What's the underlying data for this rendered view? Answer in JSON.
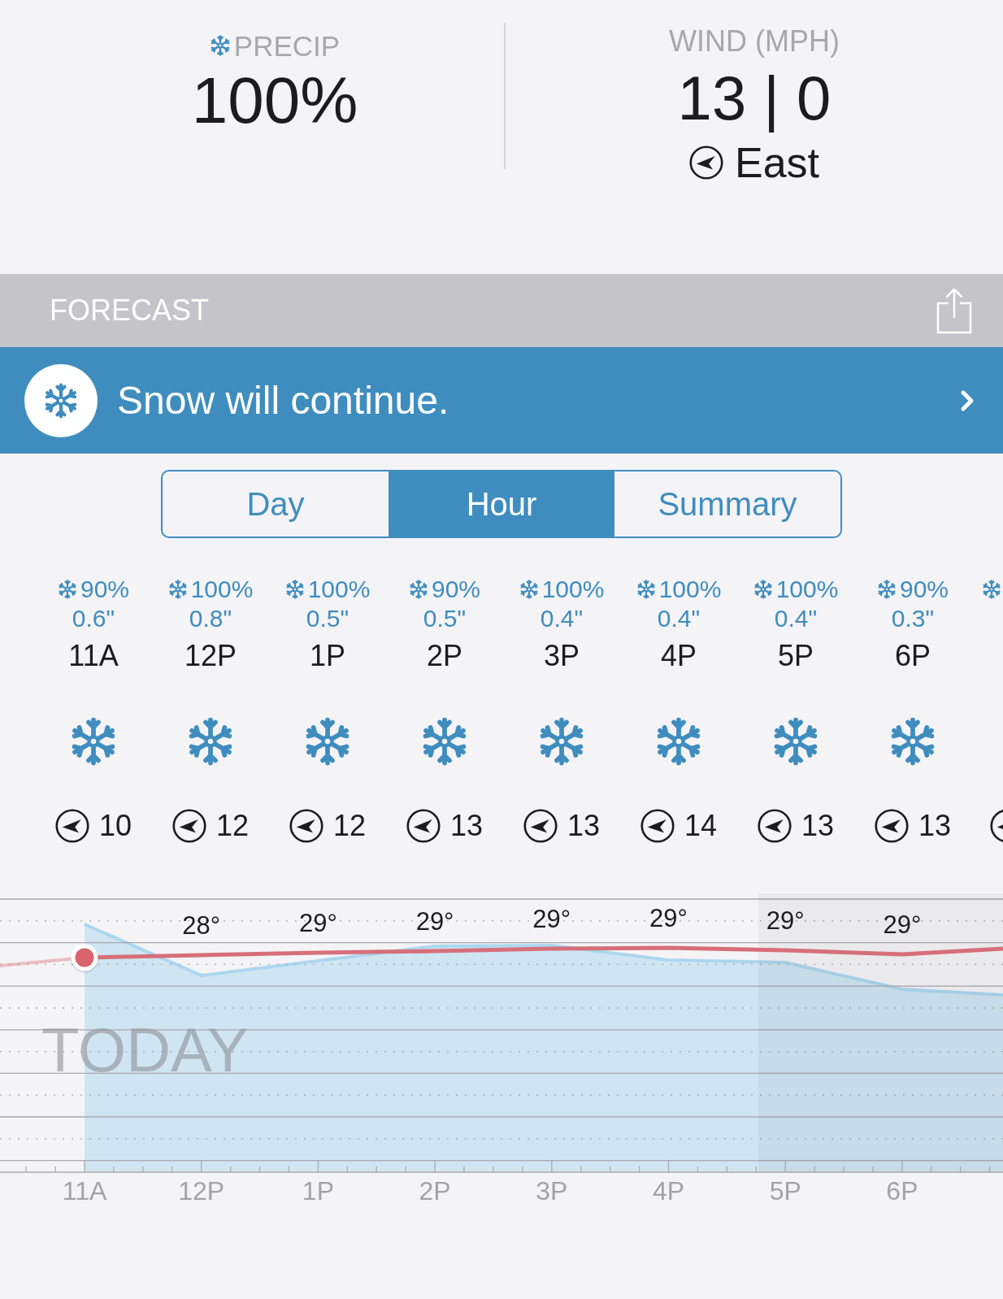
{
  "current": {
    "precip": {
      "label": "PRECIP",
      "value": "100%"
    },
    "wind": {
      "label": "WIND (MPH)",
      "value": "13 | 0",
      "direction": "East"
    }
  },
  "forecast": {
    "title": "FORECAST"
  },
  "alert": {
    "text": "Snow will continue."
  },
  "tabs": [
    {
      "label": "Day",
      "selected": false
    },
    {
      "label": "Hour",
      "selected": true
    },
    {
      "label": "Summary",
      "selected": false
    }
  ],
  "hours": [
    {
      "precip_chance": "90%",
      "precip_amount": "0.6\"",
      "time": "11A",
      "wind_speed": "10"
    },
    {
      "precip_chance": "100%",
      "precip_amount": "0.8\"",
      "time": "12P",
      "wind_speed": "12"
    },
    {
      "precip_chance": "100%",
      "precip_amount": "0.5\"",
      "time": "1P",
      "wind_speed": "12"
    },
    {
      "precip_chance": "90%",
      "precip_amount": "0.5\"",
      "time": "2P",
      "wind_speed": "13"
    },
    {
      "precip_chance": "100%",
      "precip_amount": "0.4\"",
      "time": "3P",
      "wind_speed": "13"
    },
    {
      "precip_chance": "100%",
      "precip_amount": "0.4\"",
      "time": "4P",
      "wind_speed": "14"
    },
    {
      "precip_chance": "100%",
      "precip_amount": "0.4\"",
      "time": "5P",
      "wind_speed": "13"
    },
    {
      "precip_chance": "90%",
      "precip_amount": "0.3\"",
      "time": "6P",
      "wind_speed": "13"
    }
  ],
  "chart": {
    "label": "TODAY",
    "columns": [
      {
        "time": "11A"
      },
      {
        "time": "12P",
        "temperature": "28°"
      },
      {
        "time": "1P",
        "temperature": "29°"
      },
      {
        "time": "2P",
        "temperature": "29°"
      },
      {
        "time": "3P",
        "temperature": "29°"
      },
      {
        "time": "4P",
        "temperature": "29°"
      },
      {
        "time": "5P",
        "temperature": "29°"
      },
      {
        "time": "6P",
        "temperature": "29°"
      }
    ]
  }
}
